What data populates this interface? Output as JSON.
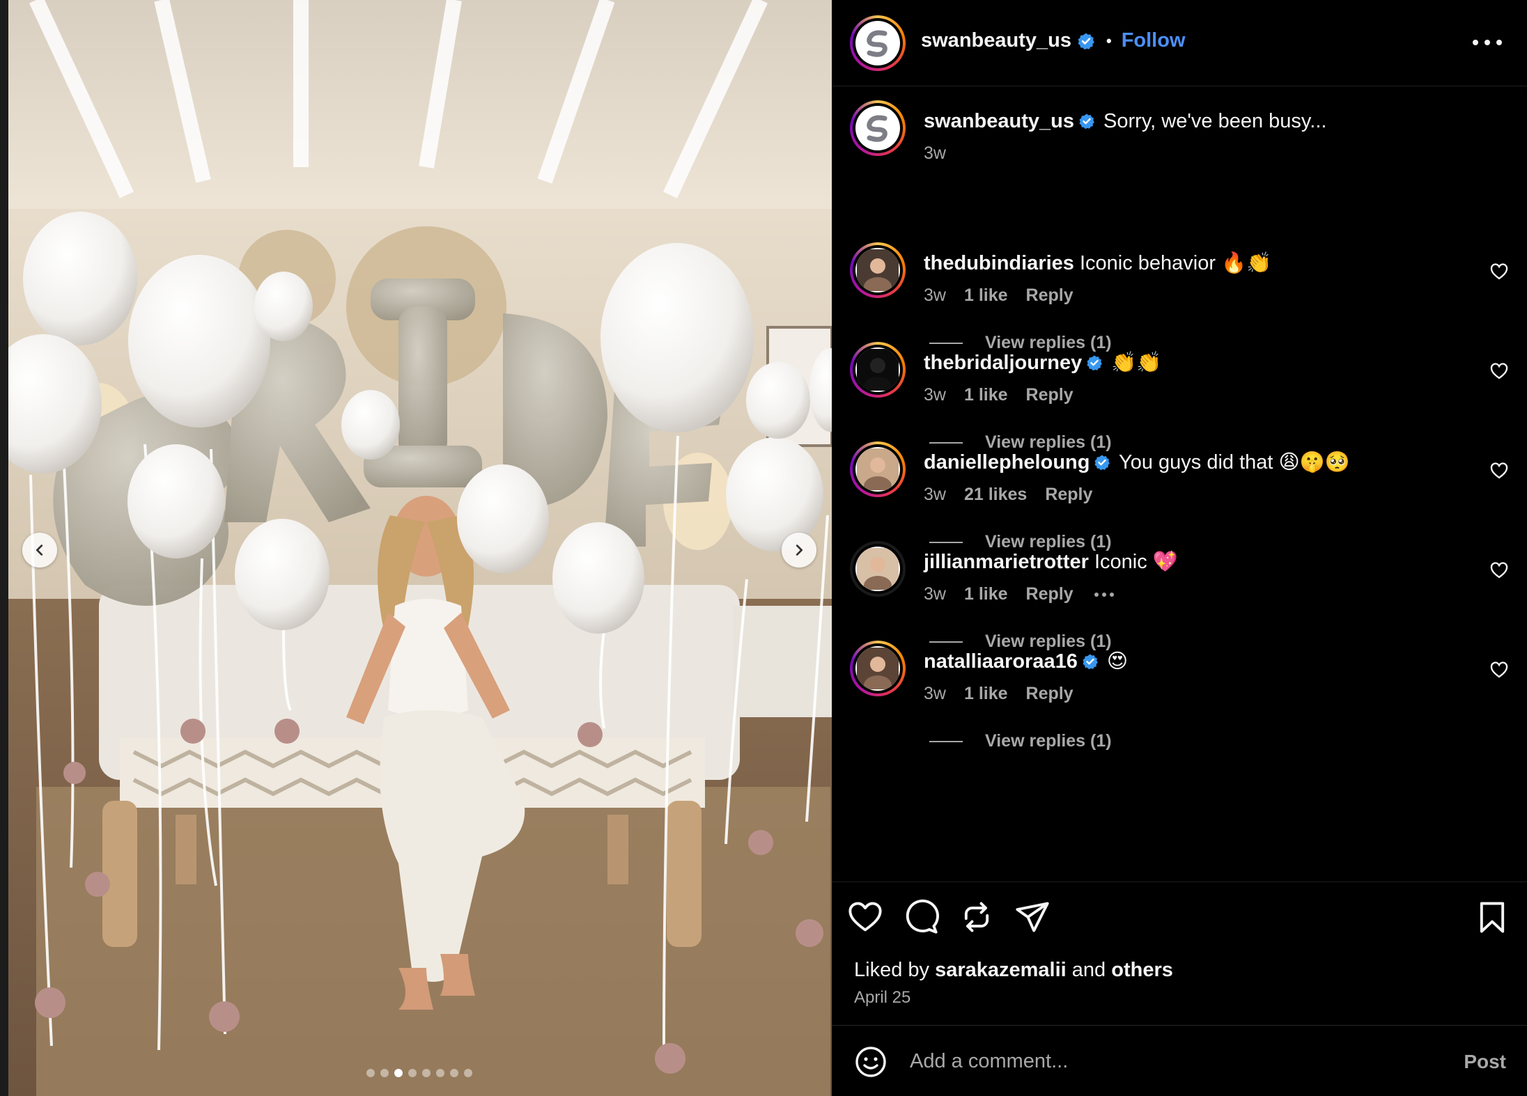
{
  "post": {
    "author": "swanbeauty_us",
    "follow_label": "Follow",
    "separator": "•"
  },
  "carousel": {
    "slide_count": 8,
    "active_index": 2
  },
  "comments": [
    {
      "user": "swanbeauty_us",
      "verified": true,
      "text": "Sorry, we've been busy...",
      "time": "3w",
      "is_caption": true
    },
    {
      "user": "thedubindiaries",
      "verified": false,
      "text": "Iconic behavior 🔥👏",
      "time": "3w",
      "likes": "1 like",
      "reply": "Reply",
      "view_replies": "View replies (1)"
    },
    {
      "user": "thebridaljourney",
      "verified": true,
      "text": "👏👏",
      "time": "3w",
      "likes": "1 like",
      "reply": "Reply",
      "view_replies": "View replies (1)"
    },
    {
      "user": "daniellepheloung",
      "verified": true,
      "text": "You guys did that 😩🤫🥺",
      "time": "3w",
      "likes": "21 likes",
      "reply": "Reply",
      "view_replies": "View replies (1)"
    },
    {
      "user": "jillianmarietrotter",
      "verified": false,
      "text": "Iconic 💖",
      "time": "3w",
      "likes": "1 like",
      "reply": "Reply",
      "view_replies": "View replies (1)"
    },
    {
      "user": "natalliaaroraa16",
      "verified": true,
      "text": "😍",
      "time": "3w",
      "likes": "1 like",
      "reply": "Reply",
      "view_replies": "View replies (1)"
    }
  ],
  "footer": {
    "liked_by_prefix": "Liked by",
    "liked_by_user": "sarakazemalii",
    "liked_by_and": "and",
    "liked_by_others": "others",
    "date": "April 25",
    "comment_placeholder": "Add a comment...",
    "post_label": "Post"
  },
  "icons": [
    "heart-icon",
    "comment-icon",
    "repost-icon",
    "share-icon",
    "bookmark-icon",
    "emoji-icon",
    "more-icon",
    "chevron-left-icon",
    "chevron-right-icon",
    "verified-icon"
  ],
  "colors": {
    "background": "#000000",
    "text": "#f5f5f5",
    "muted": "#a8a8a8",
    "link": "#4d8ff8",
    "verified": "#3897f0"
  }
}
